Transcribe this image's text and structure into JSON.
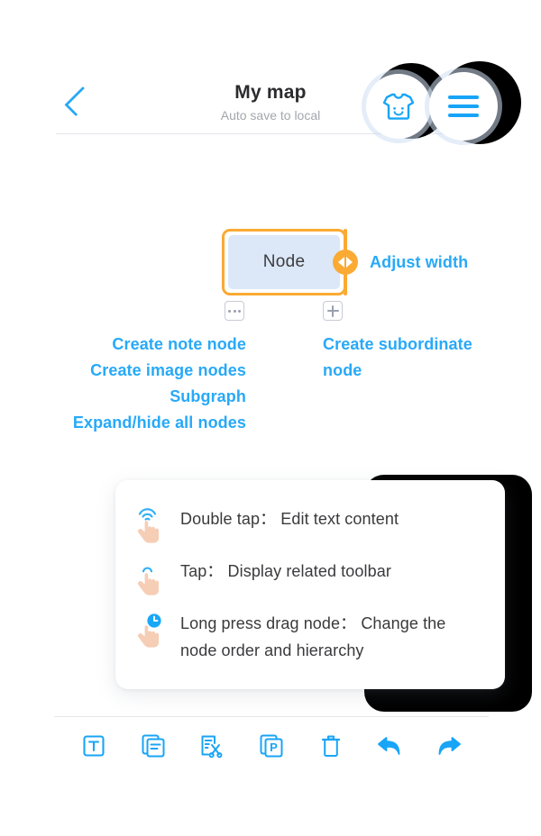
{
  "header": {
    "back_icon": "chevron-left-icon",
    "title": "My map",
    "subtitle": "Auto save to local",
    "shirt_button_icon": "shirt-icon",
    "menu_button_icon": "hamburger-menu-icon"
  },
  "node": {
    "label": "Node",
    "resize_handle_icon": "horizontal-resize-icon",
    "adjust_width_label": "Adjust width",
    "more_button_icon": "ellipsis-icon",
    "add_button_icon": "plus-icon"
  },
  "annotations": {
    "left": [
      "Create note node",
      "Create image nodes",
      "Subgraph",
      "Expand/hide all nodes"
    ],
    "right": [
      "Create subordinate",
      "node"
    ]
  },
  "gestures": [
    {
      "icon": "double-tap-hand-icon",
      "text": "Double tap： Edit text content"
    },
    {
      "icon": "tap-hand-icon",
      "text": "Tap： Display related toolbar"
    },
    {
      "icon": "long-press-hand-icon",
      "text_line1": "Long press drag node： Change the",
      "text_line2": "node order and hierarchy"
    }
  ],
  "toolbar": [
    {
      "icon": "text-node-icon",
      "label": "T"
    },
    {
      "icon": "note-node-icon",
      "label": ""
    },
    {
      "icon": "cut-node-icon",
      "label": ""
    },
    {
      "icon": "paste-node-icon",
      "label": "P"
    },
    {
      "icon": "delete-trash-icon",
      "label": ""
    },
    {
      "icon": "undo-arrow-icon",
      "label": ""
    },
    {
      "icon": "redo-arrow-icon",
      "label": ""
    }
  ],
  "colors": {
    "accent_blue": "#28a9f7",
    "node_border_orange": "#fbaa33",
    "node_fill": "#dce8f7",
    "text_dark": "#3a3a3d",
    "muted": "#a3a6ac",
    "spotlight_dark": "#000000"
  }
}
